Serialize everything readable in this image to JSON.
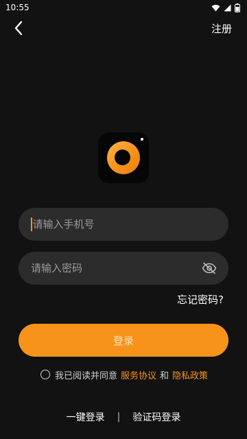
{
  "status_bar": {
    "time": "10:55"
  },
  "nav": {
    "register_label": "注册"
  },
  "form": {
    "phone_placeholder": "请输入手机号",
    "password_placeholder": "请输入密码",
    "forgot_label": "忘记密码?",
    "login_label": "登录"
  },
  "agreement": {
    "prefix": "我已阅读并同意",
    "service_link": "服务协议",
    "conjunction": "和",
    "privacy_link": "隐私政策"
  },
  "alt_login": {
    "one_click": "一键登录",
    "separator": "|",
    "code_login": "验证码登录"
  },
  "colors": {
    "background": "#121212",
    "accent": "#f7931a",
    "field_bg": "#2c2c2c"
  },
  "icons": {
    "back": "chevron-left-icon",
    "wifi": "wifi-icon",
    "signal": "signal-icon",
    "battery": "battery-icon",
    "visibility": "eye-off-icon",
    "app_logo": "ring-logo-icon"
  }
}
